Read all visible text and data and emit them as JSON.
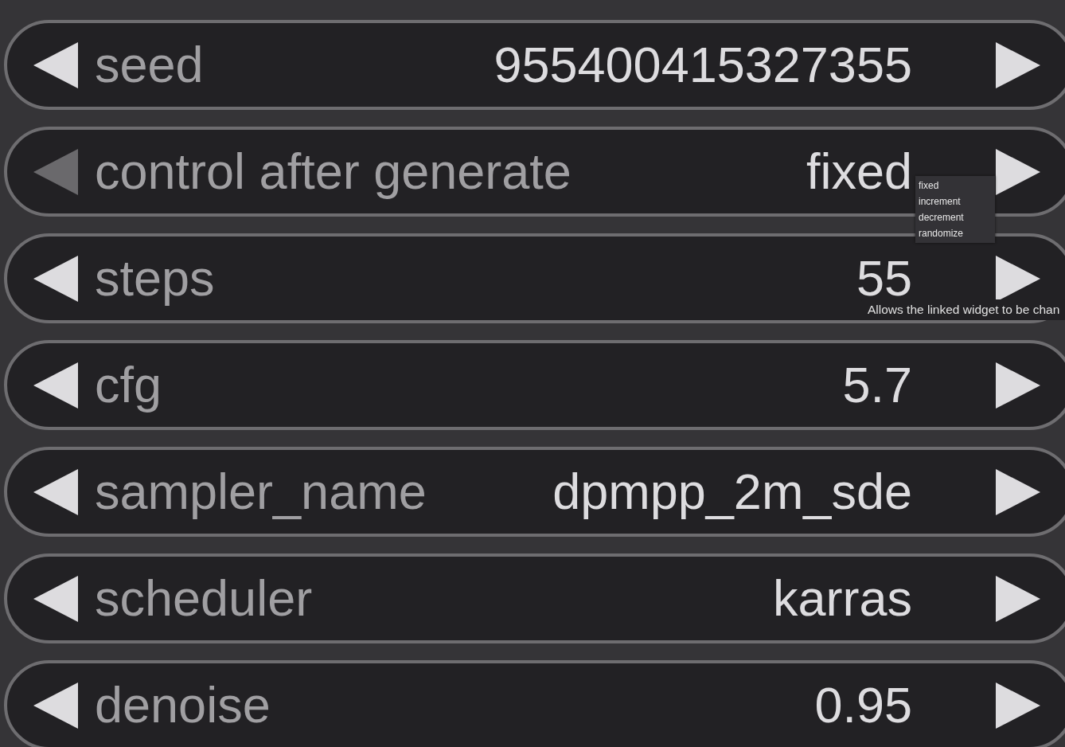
{
  "widgets": [
    {
      "label": "seed",
      "value": "955400415327355",
      "left_disabled": false
    },
    {
      "label": "control after generate",
      "value": "fixed",
      "left_disabled": true
    },
    {
      "label": "steps",
      "value": "55",
      "left_disabled": false
    },
    {
      "label": "cfg",
      "value": "5.7",
      "left_disabled": false
    },
    {
      "label": "sampler_name",
      "value": "dpmpp_2m_sde",
      "left_disabled": false
    },
    {
      "label": "scheduler",
      "value": "karras",
      "left_disabled": false
    },
    {
      "label": "denoise",
      "value": "0.95",
      "left_disabled": false
    }
  ],
  "dropdown_menu": {
    "options": [
      "fixed",
      "increment",
      "decrement",
      "randomize"
    ]
  },
  "tooltip": "Allows the linked widget to be chan"
}
